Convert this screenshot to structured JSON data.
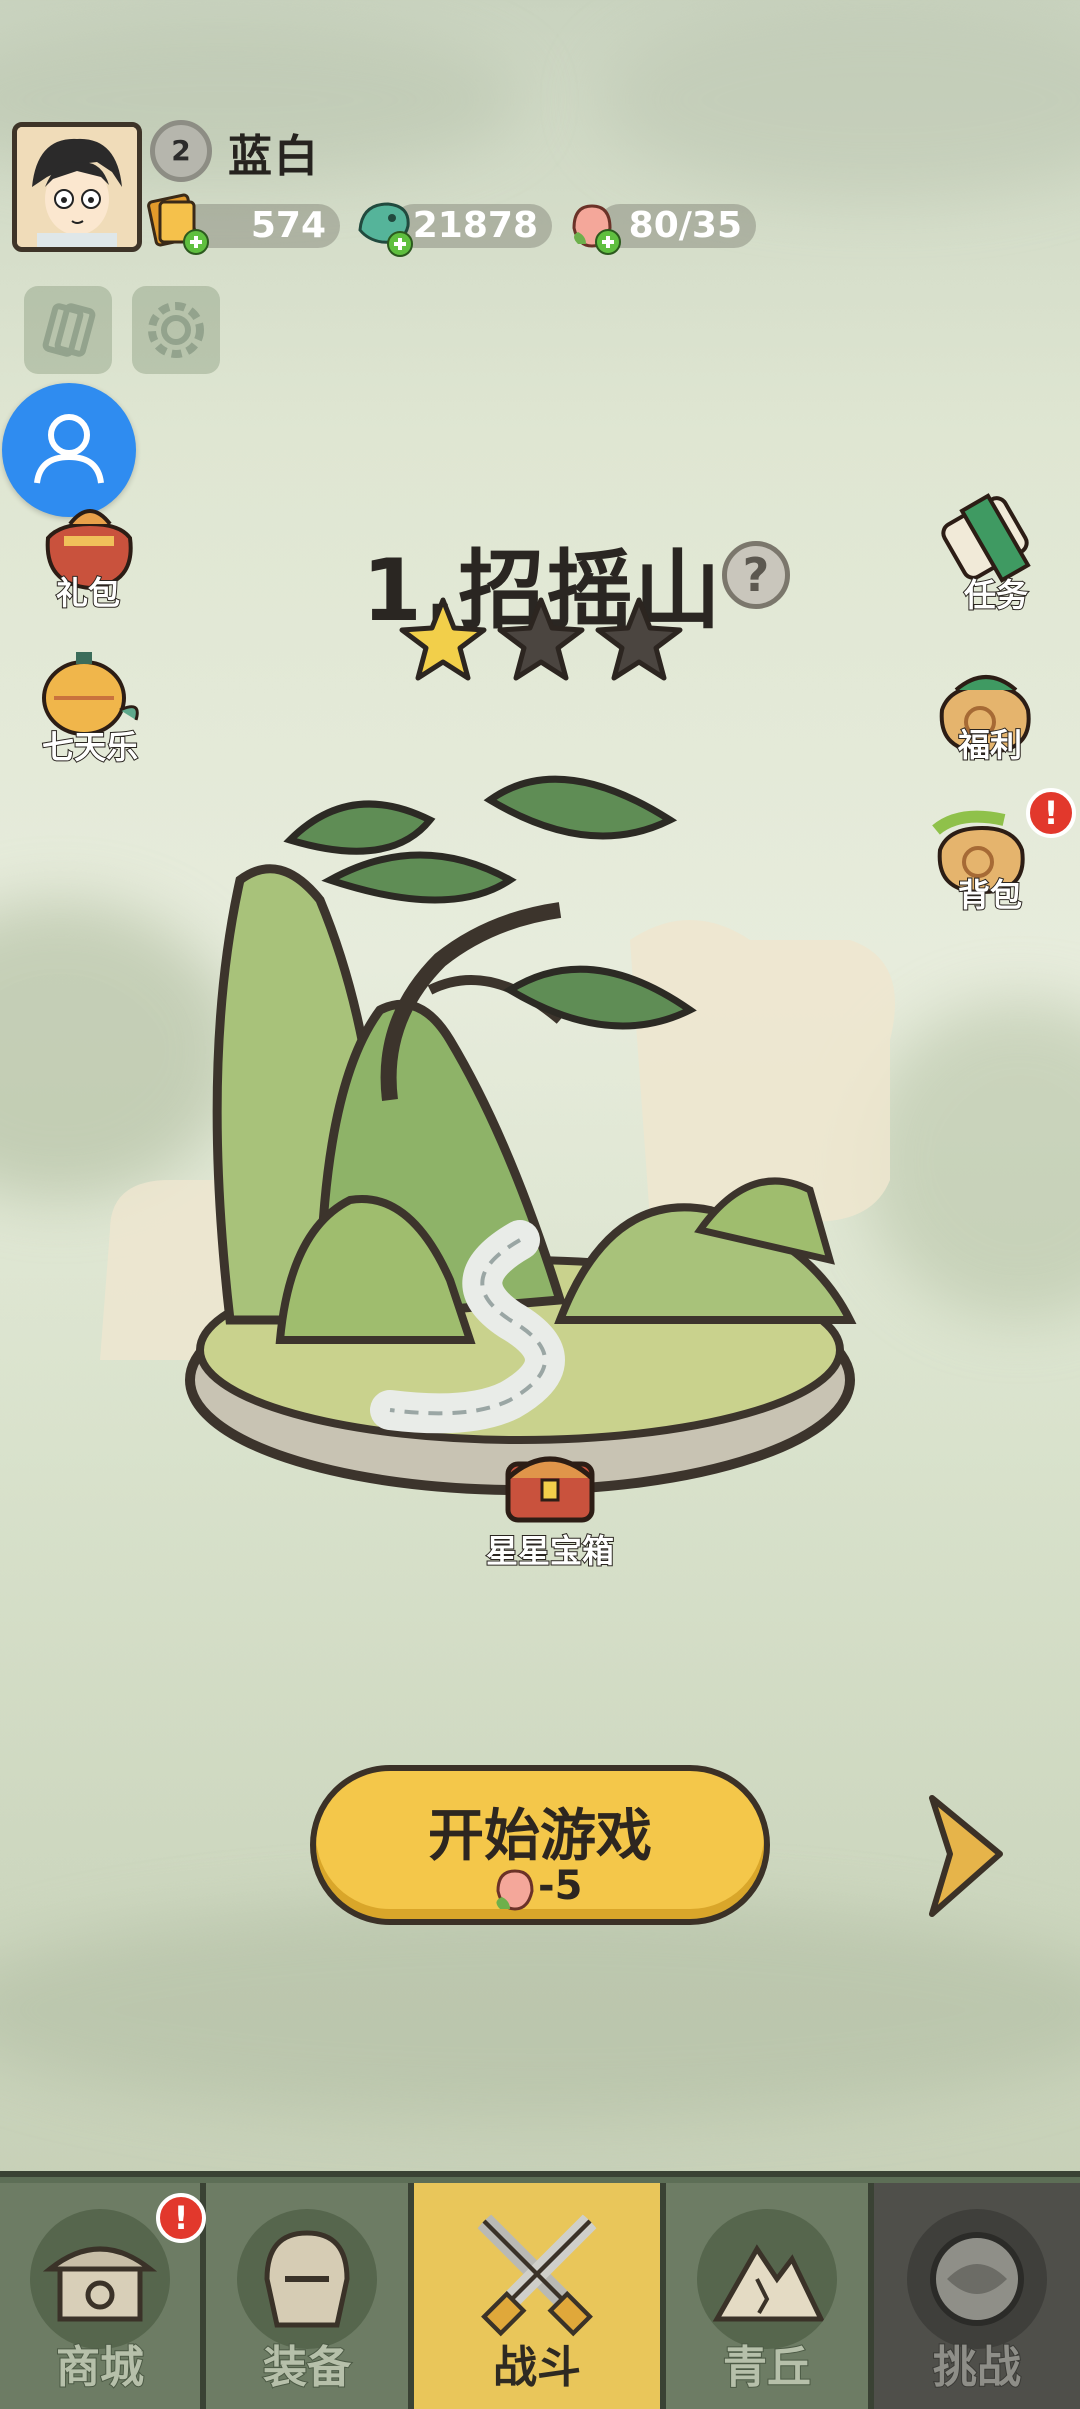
{
  "player": {
    "name": "蓝白",
    "level": "2"
  },
  "resources": {
    "tickets": "574",
    "jade": "21878",
    "stamina": "80/35"
  },
  "left_menu": {
    "gift_pack": "礼包",
    "seven_day": "七天乐"
  },
  "right_menu": {
    "tasks": "任务",
    "welfare": "福利",
    "bag": "背包",
    "bag_badge": "!"
  },
  "stage": {
    "title": "1.招摇山",
    "help": "?",
    "stars_earned": 1,
    "stars_total": 3,
    "chest_label": "星星宝箱"
  },
  "start": {
    "label": "开始游戏",
    "cost": "-5"
  },
  "nav": {
    "shop": "商城",
    "shop_badge": "!",
    "equip": "装备",
    "battle": "战斗",
    "qingqiu": "青丘",
    "challenge": "挑战"
  },
  "colors": {
    "accent": "#f4c74a",
    "badge": "#e2382c",
    "nav_bg": "#5d6e56",
    "nav_active": "#e9c65a"
  }
}
